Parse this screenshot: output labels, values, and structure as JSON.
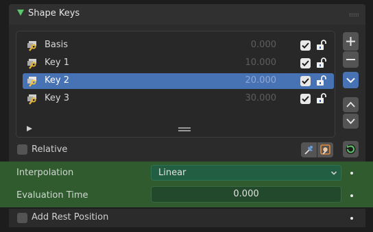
{
  "panel": {
    "title": "Shape Keys"
  },
  "shape_keys": [
    {
      "name": "Basis",
      "value": "0.000",
      "selected": false
    },
    {
      "name": "Key 1",
      "value": "10.000",
      "selected": false
    },
    {
      "name": "Key 2",
      "value": "20.000",
      "selected": true
    },
    {
      "name": "Key 3",
      "value": "30.000",
      "selected": false
    }
  ],
  "relative": {
    "label": "Relative",
    "checked": false
  },
  "interpolation": {
    "label": "Interpolation",
    "value": "Linear"
  },
  "evaluation_time": {
    "label": "Evaluation Time",
    "value": "0.000"
  },
  "add_rest_position": {
    "label": "Add Rest Position",
    "checked": false
  },
  "colors": {
    "selection": "#4772b3",
    "animated_row": "#2f5b2f",
    "panel_triangle": "#5bc86a"
  }
}
